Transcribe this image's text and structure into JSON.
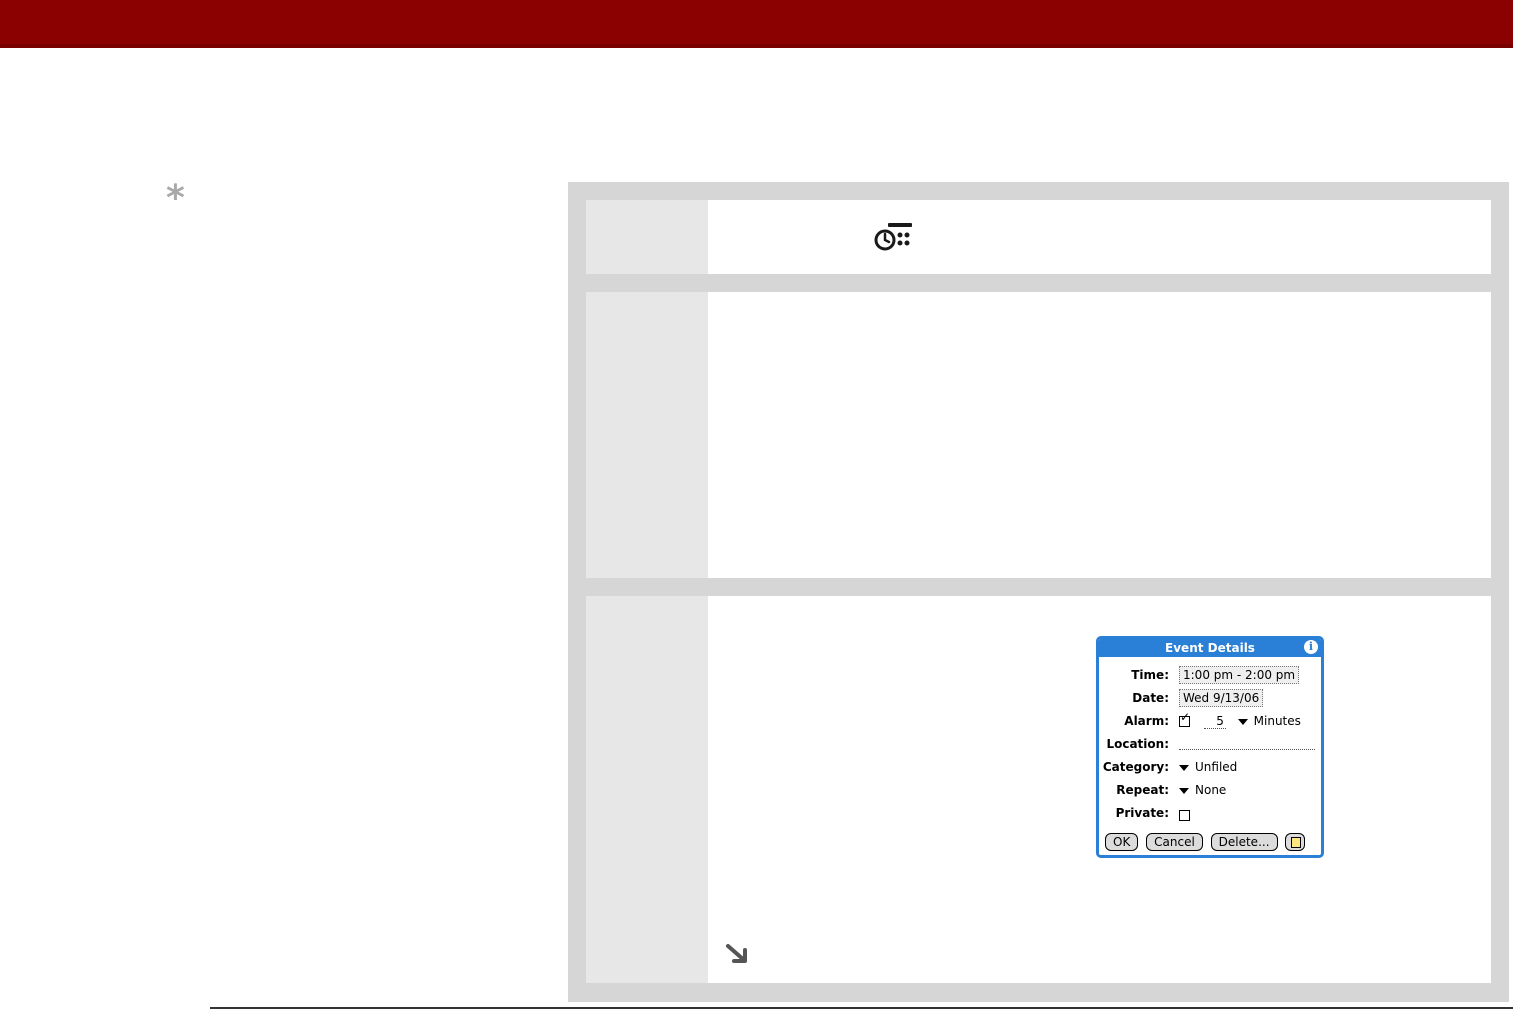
{
  "colors": {
    "header_bar": "#8b0000",
    "panel_bg": "#d6d6d6",
    "step_label_bg": "#e7e7e7",
    "dialog_accent": "#2a7fd6",
    "tip_icon": "#a9a9a9"
  },
  "icons": {
    "tip": "asterisk-icon",
    "step1": "clock-alarm-icon",
    "continued": "arrow-down-right-icon"
  },
  "tip": {
    "symbol": "*"
  },
  "dialog": {
    "title": "Event Details",
    "info_symbol": "i",
    "fields": {
      "time_label": "Time:",
      "time_value": "1:00 pm - 2:00 pm",
      "date_label": "Date:",
      "date_value": "Wed 9/13/06",
      "alarm_label": "Alarm:",
      "alarm_checked": true,
      "alarm_amount": "5",
      "alarm_unit": "Minutes",
      "location_label": "Location:",
      "location_value": "",
      "category_label": "Category:",
      "category_value": "Unfiled",
      "repeat_label": "Repeat:",
      "repeat_value": "None",
      "private_label": "Private:",
      "private_checked": false
    },
    "buttons": {
      "ok": "OK",
      "cancel": "Cancel",
      "delete": "Delete..."
    }
  }
}
